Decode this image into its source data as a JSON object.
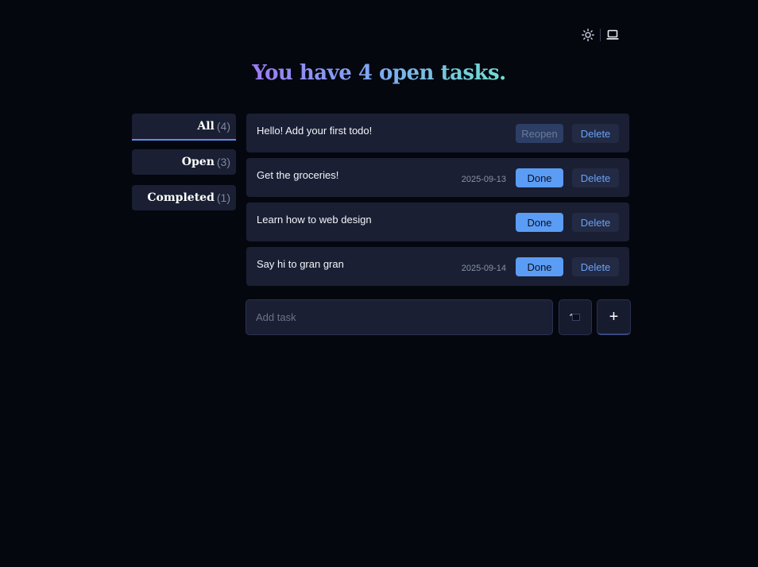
{
  "theme": {
    "light_icon": "sun-icon",
    "system_icon": "laptop-icon"
  },
  "headline": {
    "text": "You have 4 open tasks."
  },
  "filters": [
    {
      "label": "All",
      "count": "(4)",
      "active": true
    },
    {
      "label": "Open",
      "count": "(3)",
      "active": false
    },
    {
      "label": "Completed",
      "count": "(1)",
      "active": false
    }
  ],
  "tasks": [
    {
      "title": "Hello! Add your first todo!",
      "date": "",
      "action": "Reopen",
      "delete": "Delete",
      "completed": true
    },
    {
      "title": "Get the groceries!",
      "date": "2025-09-13",
      "action": "Done",
      "delete": "Delete",
      "completed": false
    },
    {
      "title": "Learn how to web design",
      "date": "",
      "action": "Done",
      "delete": "Delete",
      "completed": false
    },
    {
      "title": "Say hi to gran gran",
      "date": "2025-09-14",
      "action": "Done",
      "delete": "Delete",
      "completed": false
    }
  ],
  "add_task": {
    "placeholder": "Add task",
    "value": "",
    "date_icon": "calendar-icon",
    "add_label": "+"
  },
  "colors": {
    "background": "#05070f",
    "card": "#1a1f33",
    "accent": "#5b9cf5",
    "gradient_start": "#9b7cf4",
    "gradient_end": "#6fe0cf"
  }
}
